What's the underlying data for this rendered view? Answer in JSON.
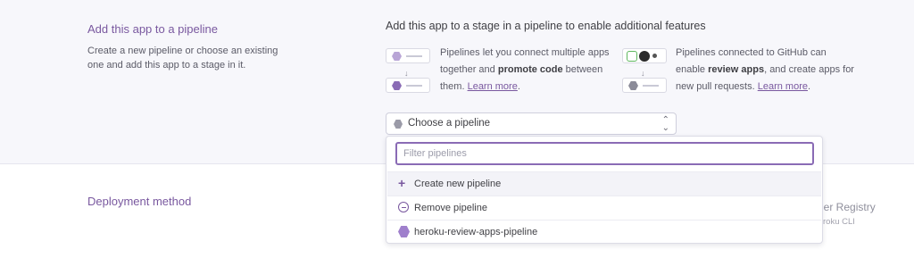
{
  "pipeline_section": {
    "title": "Add this app to a pipeline",
    "description": "Create a new pipeline or choose an existing one and add this app to a stage in it.",
    "heading": "Add this app to a stage in a pipeline to enable additional features",
    "feature_pipelines": {
      "text_before": "Pipelines let you connect multiple apps together and ",
      "bold": "promote code",
      "text_after": " between them. ",
      "link": "Learn more",
      "end": "."
    },
    "feature_github": {
      "text_before": "Pipelines connected to GitHub can enable ",
      "bold": "review apps",
      "text_after": ", and create apps for new pull requests. ",
      "link": "Learn more",
      "end": "."
    },
    "select": {
      "label": "Choose a pipeline",
      "chevron": "⌃⌄"
    },
    "dropdown": {
      "filter_placeholder": "Filter pipelines",
      "options": [
        {
          "icon": "plus-icon",
          "label": "Create new pipeline"
        },
        {
          "icon": "minus-circle-icon",
          "label": "Remove pipeline"
        },
        {
          "icon": "pipeline-hex-icon",
          "label": "heroku-review-apps-pipeline"
        }
      ]
    }
  },
  "deployment_section": {
    "title": "Deployment method",
    "obscured_option_title": "ner Registry",
    "obscured_option_sub": "roku CLI"
  },
  "colors": {
    "accent": "#79589f",
    "panel_bg": "#f7f7fb",
    "focus_border": "#8a6bb5"
  }
}
